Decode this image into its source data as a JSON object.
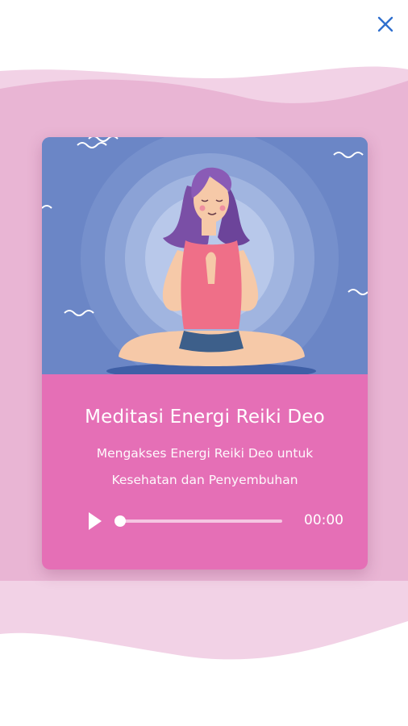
{
  "card": {
    "title": "Meditasi Energi Reiki Deo",
    "subtitle": "Mengakses Energi Reiki Deo untuk Kesehatan dan Penyembuhan"
  },
  "player": {
    "time": "00:00",
    "progress": 0,
    "play_icon": "play-icon"
  },
  "icons": {
    "close": "close-icon"
  },
  "colors": {
    "accent": "#e56fb6",
    "illustration_bg": "#6b86c6",
    "wave_pink": "#ecb3d6",
    "close_icon": "#2f6fce"
  }
}
